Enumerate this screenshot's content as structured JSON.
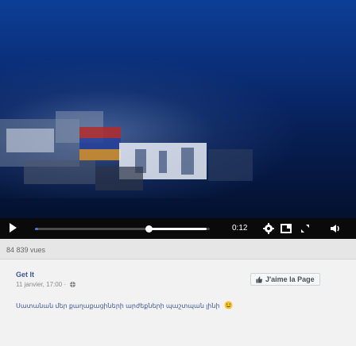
{
  "player": {
    "time_label": "0:12",
    "progress": 0.02,
    "buffered_from": 0.65,
    "buffered_to": 0.98,
    "play_icon": "play-icon",
    "settings_icon": "gear-icon",
    "quality_icon": "hd-icon",
    "fullscreen_icon": "fullscreen-icon",
    "volume_icon": "volume-icon"
  },
  "stats": {
    "views": "84 839 vues"
  },
  "post": {
    "page_name": "Get It",
    "date": "11 janvier, 17:00 ·",
    "privacy_icon": "globe-icon",
    "like_button_label": "J'aime la Page",
    "like_icon": "thumbs-up-icon",
    "caption": "Սատանան մեր քաղաքացիների արժեքների պաշտպան լինի",
    "caption_emoji": "smile-emoji-icon"
  },
  "colors": {
    "link": "#3b5998",
    "progress": "#4a76d8",
    "video_bg": "#0a2f7a"
  }
}
